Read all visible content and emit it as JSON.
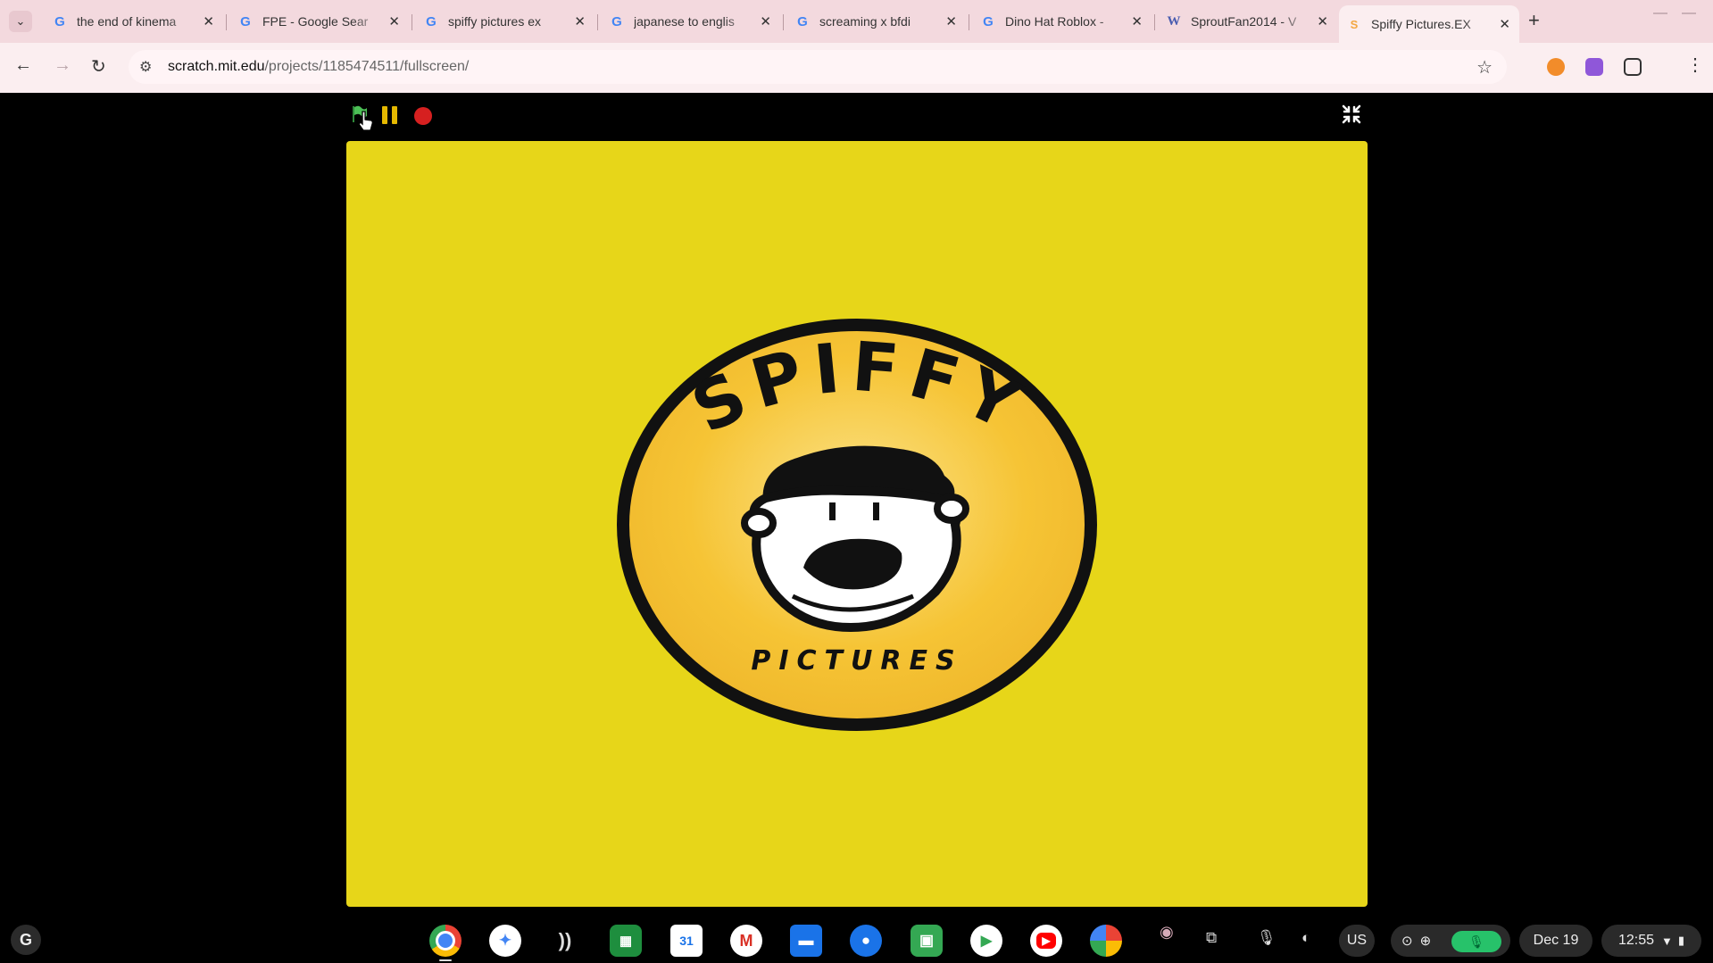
{
  "browser": {
    "tabs": [
      {
        "title": "the end of kinema",
        "favicon": "google-icon"
      },
      {
        "title": "FPE - Google Sear",
        "favicon": "google-icon"
      },
      {
        "title": "spiffy pictures ex",
        "favicon": "google-icon"
      },
      {
        "title": "japanese to englis",
        "favicon": "google-icon"
      },
      {
        "title": "screaming x bfdi",
        "favicon": "google-icon"
      },
      {
        "title": "Dino Hat Roblox -",
        "favicon": "google-icon"
      },
      {
        "title": "SproutFan2014 - V",
        "favicon": "wiki-icon"
      },
      {
        "title": "Spiffy Pictures.EX",
        "favicon": "scratch-icon",
        "active": true
      }
    ],
    "address": {
      "host": "scratch.mit.edu",
      "path": "/projects/1185474511/fullscreen/"
    }
  },
  "stage": {
    "logo": {
      "top_text": "SPIFFY",
      "bottom_text": "PICTURES"
    },
    "background_color": "#e7d619"
  },
  "shelf": {
    "apps": [
      "chrome-icon",
      "assistant-icon",
      "cast-icon",
      "app-grid-icon",
      "calendar-icon",
      "gmail-icon",
      "files-icon",
      "chat-icon",
      "meet-icon",
      "play-store-icon",
      "youtube-icon",
      "photos-icon"
    ],
    "locale": "US",
    "date": "Dec 19",
    "time": "12:55"
  }
}
